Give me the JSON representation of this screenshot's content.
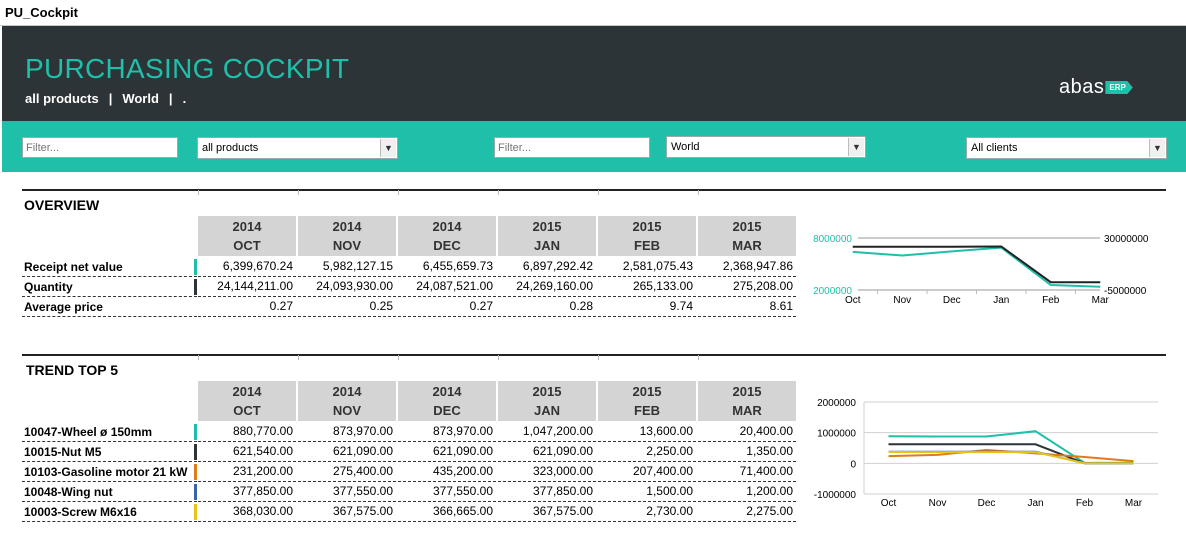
{
  "window": {
    "title": "PU_Cockpit"
  },
  "header": {
    "title": "PURCHASING COCKPIT",
    "breadcrumb": [
      "all products",
      "World",
      "."
    ],
    "logo_text": "abas",
    "logo_badge": "ERP"
  },
  "filters": {
    "product_filter_placeholder": "Filter...",
    "product_select": "all products",
    "region_filter_placeholder": "Filter...",
    "region_select": "World",
    "client_select": "All clients"
  },
  "months": [
    {
      "year": "2014",
      "month": "OCT"
    },
    {
      "year": "2014",
      "month": "NOV"
    },
    {
      "year": "2014",
      "month": "DEC"
    },
    {
      "year": "2015",
      "month": "JAN"
    },
    {
      "year": "2015",
      "month": "FEB"
    },
    {
      "year": "2015",
      "month": "MAR"
    }
  ],
  "overview": {
    "title": "OVERVIEW",
    "rows": [
      {
        "label": "Receipt net value",
        "color": "#1fbfa9",
        "values": [
          "6,399,670.24",
          "5,982,127.15",
          "6,455,659.73",
          "6,897,292.42",
          "2,581,075.43",
          "2,368,947.86"
        ]
      },
      {
        "label": "Quantity",
        "color": "#2c3437",
        "values": [
          "24,144,211.00",
          "24,093,930.00",
          "24,087,521.00",
          "24,269,160.00",
          "265,133.00",
          "275,208.00"
        ]
      },
      {
        "label": "Average price",
        "color": "",
        "values": [
          "0.27",
          "0.25",
          "0.27",
          "0.28",
          "9.74",
          "8.61"
        ]
      }
    ]
  },
  "trend": {
    "title": "TREND TOP 5",
    "rows": [
      {
        "label": "10047-Wheel ø 150mm",
        "color": "#1fbfa9",
        "values": [
          "880,770.00",
          "873,970.00",
          "873,970.00",
          "1,047,200.00",
          "13,600.00",
          "20,400.00"
        ]
      },
      {
        "label": "10015-Nut M5",
        "color": "#2c3437",
        "values": [
          "621,540.00",
          "621,090.00",
          "621,090.00",
          "621,090.00",
          "2,250.00",
          "1,350.00"
        ]
      },
      {
        "label": "10103-Gasoline motor 21 kW",
        "color": "#e07b1a",
        "values": [
          "231,200.00",
          "275,400.00",
          "435,200.00",
          "323,000.00",
          "207,400.00",
          "71,400.00"
        ]
      },
      {
        "label": "10048-Wing nut",
        "color": "#3a62a8",
        "values": [
          "377,850.00",
          "377,550.00",
          "377,550.00",
          "377,850.00",
          "1,500.00",
          "1,200.00"
        ]
      },
      {
        "label": "10003-Screw M6x16",
        "color": "#e8c31a",
        "values": [
          "368,030.00",
          "367,575.00",
          "366,665.00",
          "367,575.00",
          "2,730.00",
          "2,275.00"
        ]
      }
    ]
  },
  "chart_data": [
    {
      "type": "line",
      "categories": [
        "Oct",
        "Nov",
        "Dec",
        "Jan",
        "Feb",
        "Mar"
      ],
      "left_axis": {
        "ticks": [
          "8000000",
          "2000000"
        ],
        "range": [
          2000000,
          8000000
        ],
        "color": "#1fbfa9"
      },
      "right_axis": {
        "ticks": [
          "30000000",
          "-5000000"
        ],
        "range": [
          -5000000,
          30000000
        ]
      },
      "series": [
        {
          "axis": "left",
          "color": "#1fbfa9",
          "values": [
            6399670.24,
            5982127.15,
            6455659.73,
            6897292.42,
            2581075.43,
            2368947.86
          ]
        },
        {
          "axis": "right",
          "color": "#222222",
          "values": [
            24144211,
            24093930,
            24087521,
            24269160,
            265133,
            275208
          ]
        }
      ]
    },
    {
      "type": "line",
      "categories": [
        "Oct",
        "Nov",
        "Dec",
        "Jan",
        "Feb",
        "Mar"
      ],
      "y_ticks": [
        "2000000",
        "1000000",
        "0",
        "-1000000"
      ],
      "ylim": [
        -1000000,
        2000000
      ],
      "grid": true,
      "series": [
        {
          "color": "#1fbfa9",
          "values": [
            880770,
            873970,
            873970,
            1047200,
            13600,
            20400
          ]
        },
        {
          "color": "#2c3437",
          "values": [
            621540,
            621090,
            621090,
            621090,
            2250,
            1350
          ]
        },
        {
          "color": "#e07b1a",
          "values": [
            231200,
            275400,
            435200,
            323000,
            207400,
            71400
          ]
        },
        {
          "color": "#3a62a8",
          "values": [
            377850,
            377550,
            377550,
            377850,
            1500,
            1200
          ]
        },
        {
          "color": "#e8c31a",
          "values": [
            368030,
            367575,
            366665,
            367575,
            2730,
            2275
          ]
        }
      ]
    }
  ]
}
